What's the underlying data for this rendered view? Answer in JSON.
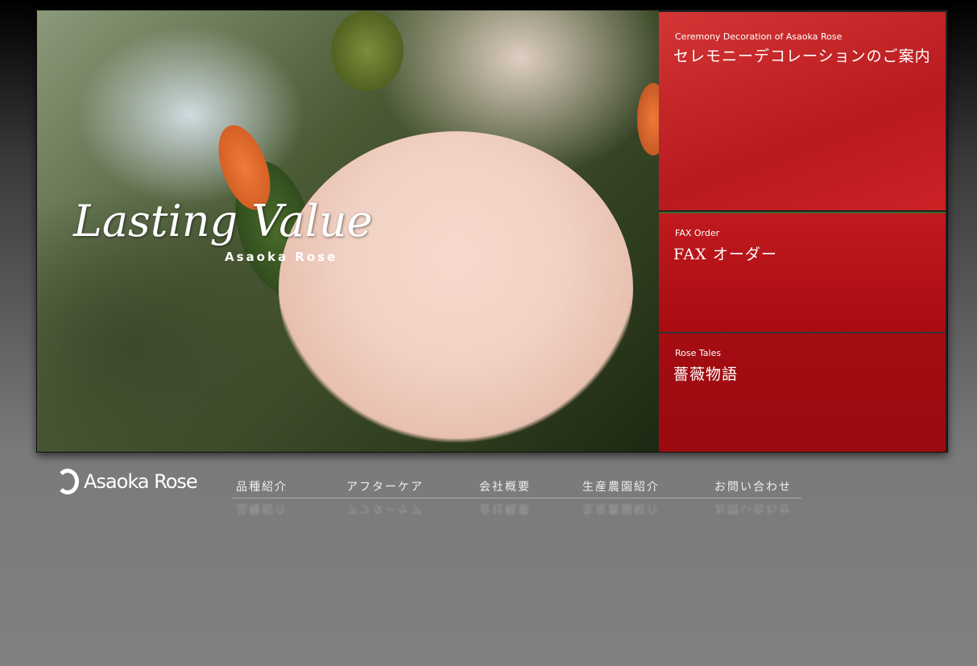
{
  "hero": {
    "title": "Lasting Value",
    "subtitle": "Asaoka Rose"
  },
  "panels": [
    {
      "en": "Ceremony Decoration of Asaoka Rose",
      "jp": "セレモニーデコレーションのご案内"
    },
    {
      "en": "FAX Order",
      "jp": "FAX オーダー"
    },
    {
      "en": "Rose Tales",
      "jp": "薔薇物語"
    }
  ],
  "logo": {
    "text": "Asaoka Rose"
  },
  "nav": [
    "品種紹介",
    "アフターケア",
    "会社概要",
    "生産農園紹介",
    "お問い合わせ"
  ]
}
